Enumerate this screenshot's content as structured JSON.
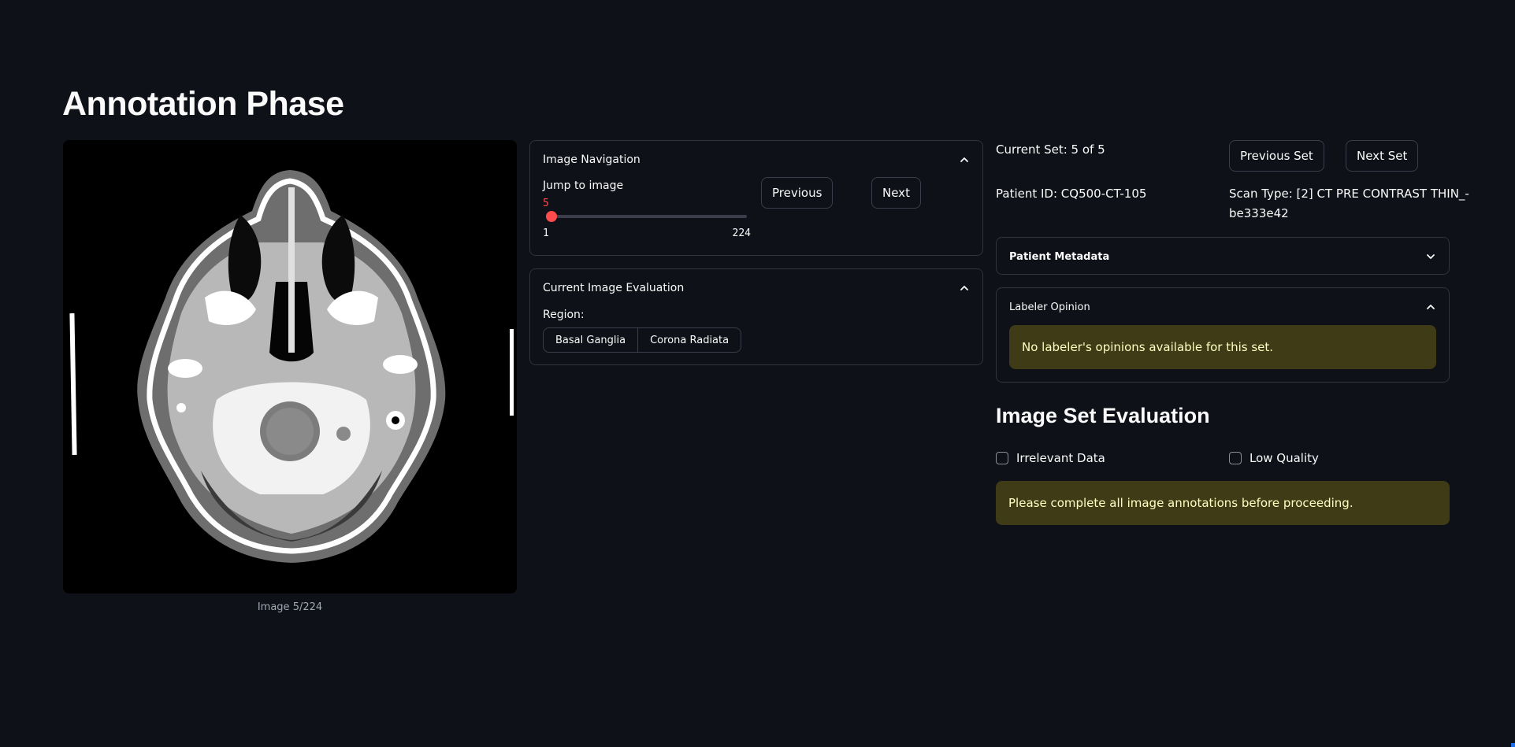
{
  "page": {
    "title": "Annotation Phase"
  },
  "scan": {
    "caption": "Image 5/224"
  },
  "image_navigation": {
    "header": "Image Navigation",
    "jump_label": "Jump to image",
    "slider": {
      "value": 5,
      "min": 1,
      "max": 224,
      "value_text": "5",
      "min_text": "1",
      "max_text": "224"
    },
    "previous_label": "Previous",
    "next_label": "Next"
  },
  "current_evaluation": {
    "header": "Current Image Evaluation",
    "region_label": "Region:",
    "regions": [
      "Basal Ganglia",
      "Corona Radiata"
    ]
  },
  "set_info": {
    "current_set": "Current Set: 5 of 5",
    "previous_set_label": "Previous Set",
    "next_set_label": "Next Set",
    "patient_id": "Patient ID: CQ500-CT-105",
    "scan_type_line1": "Scan Type: [2] CT PRE CONTRAST THIN_-",
    "scan_type_line2": "be333e42"
  },
  "patient_metadata": {
    "header": "Patient Metadata"
  },
  "labeler_opinion": {
    "header": "Labeler Opinion",
    "message": "No labeler's opinions available for this set."
  },
  "image_set_evaluation": {
    "title": "Image Set Evaluation",
    "irrelevant_label": "Irrelevant Data",
    "low_quality_label": "Low Quality",
    "warning": "Please complete all image annotations before proceeding."
  },
  "colors": {
    "background": "#0e1117",
    "accent": "#ff4b4b",
    "warning_bg": "#3e3b16",
    "warning_text": "#ffffc2"
  },
  "icons": {
    "expander_open": "chevron-up-icon",
    "expander_closed": "chevron-down-icon"
  }
}
